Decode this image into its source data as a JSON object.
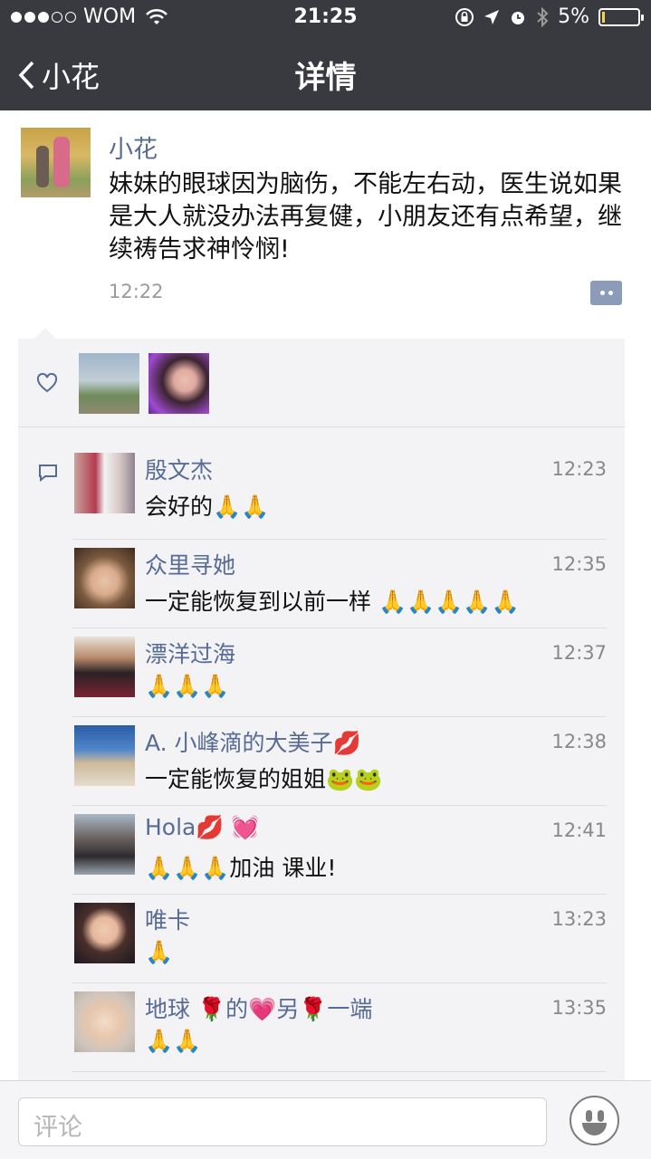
{
  "status_bar": {
    "carrier": "WOM",
    "time": "21:25",
    "battery": "5%"
  },
  "nav": {
    "back_label": "小花",
    "title": "详情"
  },
  "post": {
    "author": "小花",
    "text": "妹妹的眼球因为脑伤，不能左右动，医生说如果是大人就没办法再复健，小朋友还有点希望，继续祷告求神怜悯!",
    "time": "12:22"
  },
  "comments": [
    {
      "name": "殷文杰",
      "time": "12:23",
      "text": "会好的🙏🙏"
    },
    {
      "name": "众里寻她",
      "time": "12:35",
      "text": "一定能恢复到以前一样 🙏🙏🙏🙏🙏"
    },
    {
      "name": "漂洋过海",
      "time": "12:37",
      "text": "🙏🙏🙏"
    },
    {
      "name": "A. 小峰滴的大美子💋",
      "time": "12:38",
      "text": "一定能恢复的姐姐🐸🐸"
    },
    {
      "name": "Hola💋 💓",
      "time": "12:41",
      "text": "🙏🙏🙏加油 课业!"
    },
    {
      "name": "唯卡",
      "time": "13:23",
      "text": "🙏"
    },
    {
      "name": "地球 🌹的💗另🌹一端",
      "time": "13:35",
      "text": "🙏🙏"
    }
  ],
  "input": {
    "placeholder": "评论"
  }
}
